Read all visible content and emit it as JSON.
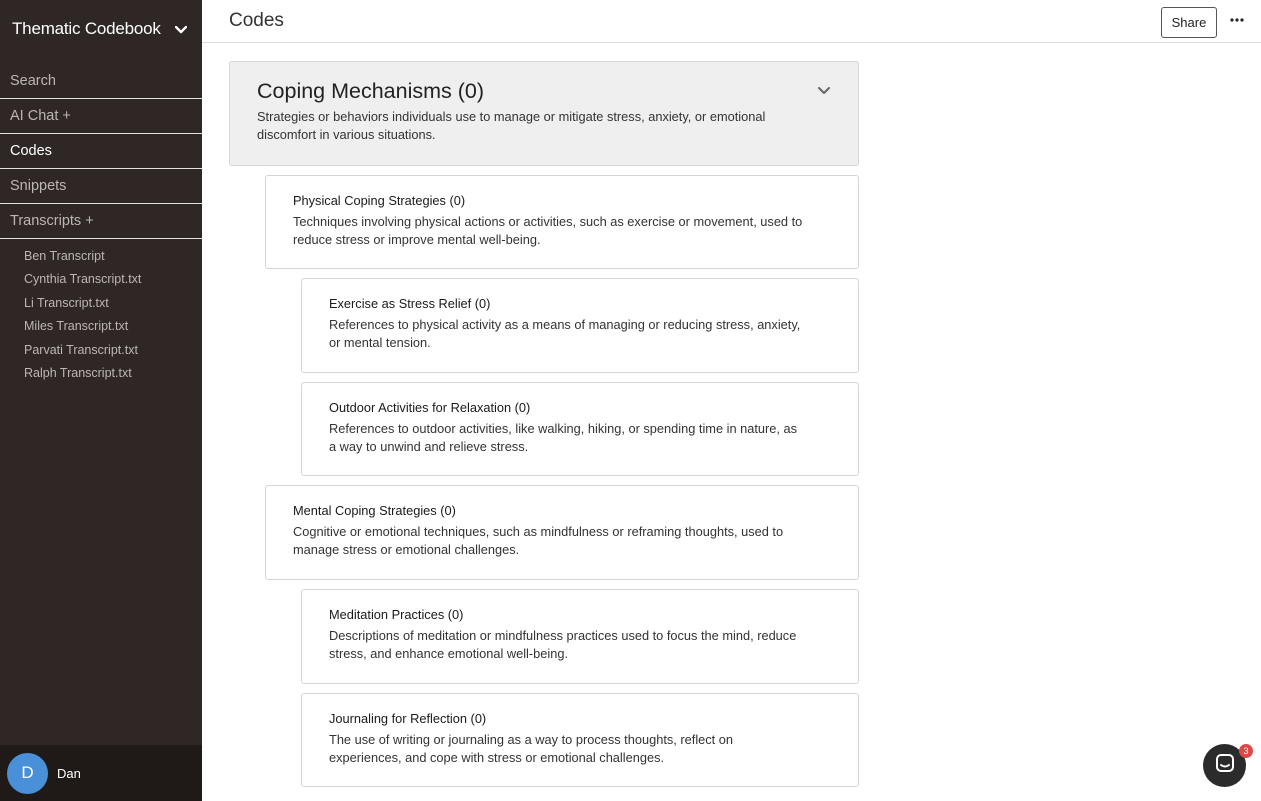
{
  "sidebar": {
    "title": "Thematic Codebook",
    "nav": [
      {
        "label": "Search"
      },
      {
        "label": "AI Chat +"
      },
      {
        "label": "Codes"
      },
      {
        "label": "Snippets"
      },
      {
        "label": "Transcripts +"
      }
    ],
    "transcripts": [
      "Ben Transcript",
      "Cynthia Transcript.txt",
      "Li Transcript.txt",
      "Miles Transcript.txt",
      "Parvati Transcript.txt",
      "Ralph Transcript.txt"
    ],
    "user": {
      "initial": "D",
      "name": "Dan"
    }
  },
  "header": {
    "title": "Codes",
    "share_label": "Share"
  },
  "codes": [
    {
      "title": "Coping Mechanisms (0)",
      "description": "Strategies or behaviors individuals use to manage or mitigate stress, anxiety, or emotional discomfort in various situations."
    },
    {
      "title": "Physical Coping Strategies (0)",
      "description": "Techniques involving physical actions or activities, such as exercise or movement, used to reduce stress or improve mental well-being."
    },
    {
      "title": "Exercise as Stress Relief (0)",
      "description": "References to physical activity as a means of managing or reducing stress, anxiety, or mental tension."
    },
    {
      "title": "Outdoor Activities for Relaxation (0)",
      "description": "References to outdoor activities, like walking, hiking, or spending time in nature, as a way to unwind and relieve stress."
    },
    {
      "title": "Mental Coping Strategies (0)",
      "description": "Cognitive or emotional techniques, such as mindfulness or reframing thoughts, used to manage stress or emotional challenges."
    },
    {
      "title": "Meditation Practices (0)",
      "description": "Descriptions of meditation or mindfulness practices used to focus the mind, reduce stress, and enhance emotional well-being."
    },
    {
      "title": "Journaling for Reflection (0)",
      "description": "The use of writing or journaling as a way to process thoughts, reflect on experiences, and cope with stress or emotional challenges."
    }
  ],
  "chat": {
    "badge_count": "3"
  },
  "colors": {
    "sidebar_bg": "#2e2725",
    "avatar": "#4a90d9",
    "badge": "#e04848"
  }
}
